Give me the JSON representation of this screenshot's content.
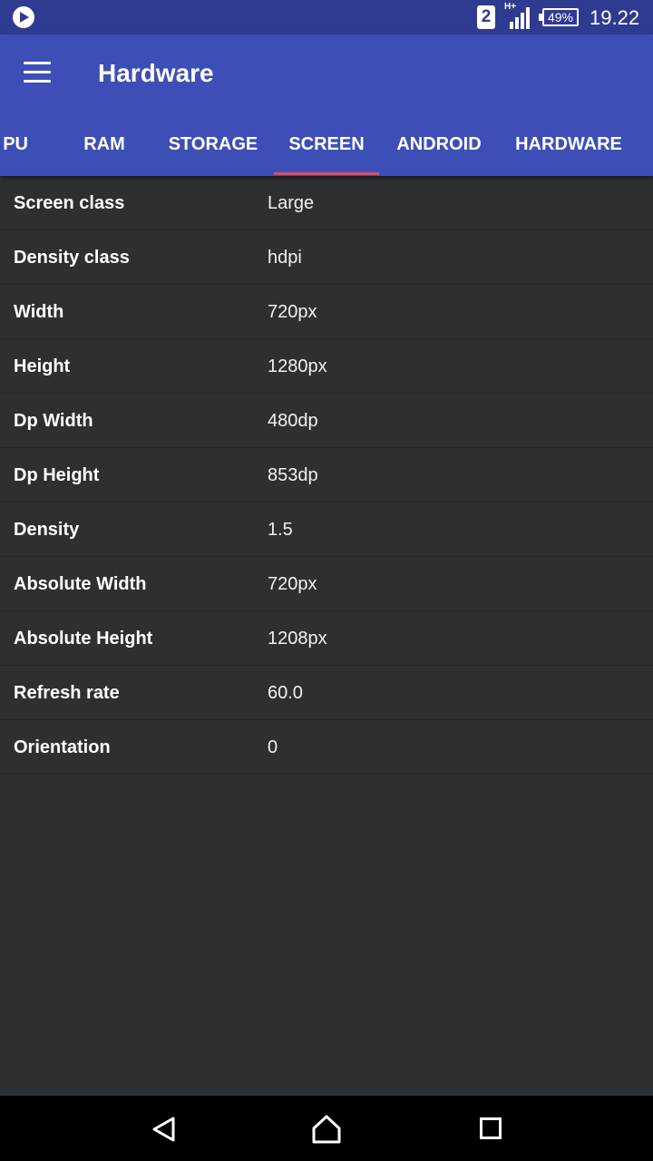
{
  "status_bar": {
    "sim_slot": "2",
    "network_type": "H+",
    "battery": "49%",
    "time": "19.22"
  },
  "app_bar": {
    "title": "Hardware"
  },
  "tabs": [
    {
      "label": "PU"
    },
    {
      "label": "RAM"
    },
    {
      "label": "STORAGE"
    },
    {
      "label": "SCREEN",
      "selected": true
    },
    {
      "label": "ANDROID"
    },
    {
      "label": "HARDWARE"
    }
  ],
  "accent_color": "#e84a54",
  "primary_color": "#3d4fb6",
  "screen_info": [
    {
      "key": "Screen class",
      "value": "Large"
    },
    {
      "key": "Density class",
      "value": "hdpi"
    },
    {
      "key": "Width",
      "value": "720px"
    },
    {
      "key": "Height",
      "value": "1280px"
    },
    {
      "key": "Dp Width",
      "value": "480dp"
    },
    {
      "key": "Dp Height",
      "value": "853dp"
    },
    {
      "key": "Density",
      "value": "1.5"
    },
    {
      "key": "Absolute Width",
      "value": "720px"
    },
    {
      "key": "Absolute Height",
      "value": "1208px"
    },
    {
      "key": "Refresh rate",
      "value": "60.0"
    },
    {
      "key": "Orientation",
      "value": "0"
    }
  ],
  "nav_icons": [
    "back-icon",
    "home-icon",
    "recent-apps-icon"
  ]
}
